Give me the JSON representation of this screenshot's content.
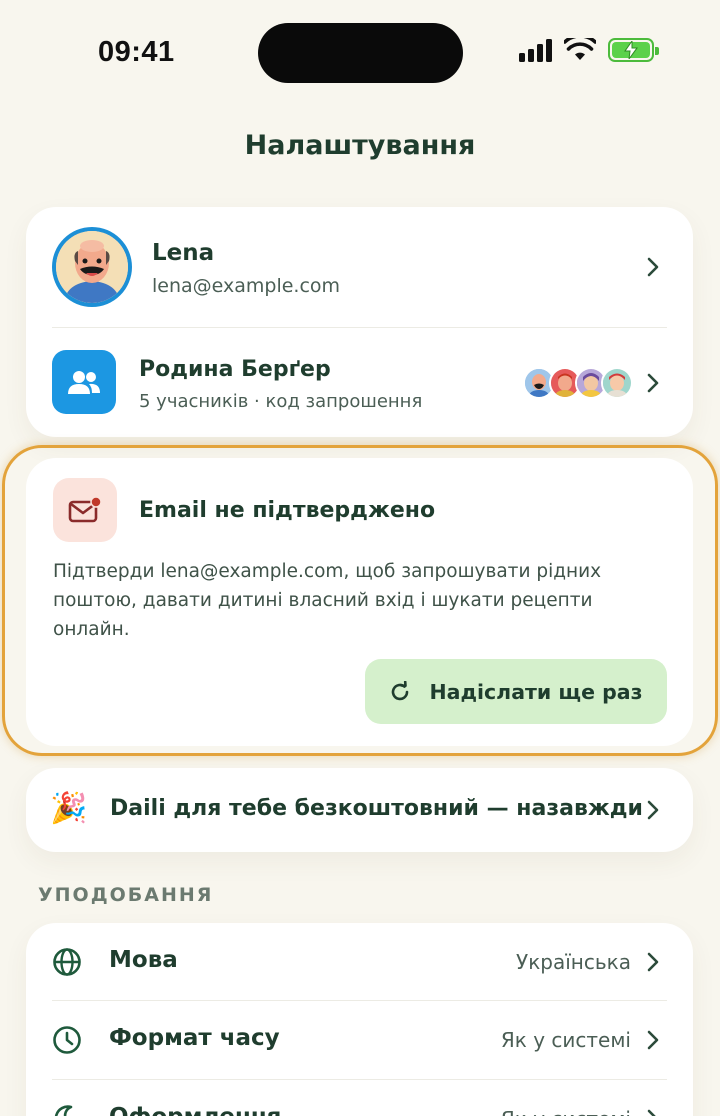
{
  "status_bar": {
    "time": "09:41"
  },
  "page": {
    "title": "Налаштування"
  },
  "profile": {
    "name": "Lena",
    "email": "lena@example.com"
  },
  "family": {
    "name": "Родина Берґер",
    "subtitle": "5 учасників · код запрошення"
  },
  "email_warning": {
    "title": "Email не підтверджено",
    "body": "Підтверди lena@example.com, щоб запрошувати рідних поштою, давати дитині власний вхід і шукати рецепти онлайн.",
    "button_label": "Надіслати ще раз"
  },
  "promo": {
    "emoji": "🎉",
    "text": "Daili для тебе безкоштовний — назавжди"
  },
  "preferences": {
    "section_label": "УПОДОБАННЯ",
    "items": [
      {
        "label": "Мова",
        "value": "Українська",
        "icon": "globe-icon"
      },
      {
        "label": "Формат часу",
        "value": "Як у системі",
        "icon": "clock-icon"
      },
      {
        "label": "Оформлення",
        "value": "Як у системі",
        "icon": "moon-icon"
      }
    ]
  },
  "colors": {
    "background": "#f8f6ee",
    "text_primary": "#1f3d2e",
    "accent_blue": "#1c97e2",
    "highlight": "#e3a33b",
    "button_green": "#d5f0cc",
    "mail_bg": "#fbe3dc"
  }
}
